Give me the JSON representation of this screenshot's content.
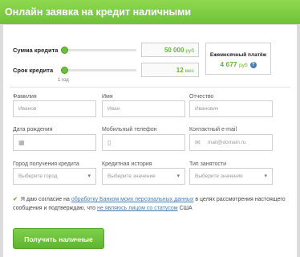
{
  "header": {
    "title": "Онлайн заявка на кредит наличными"
  },
  "sliders": [
    {
      "label": "Сумма кредита",
      "value": "50 000",
      "unit": "руб",
      "level": 0,
      "tick": ""
    },
    {
      "label": "Срок кредита",
      "value": "12",
      "unit": "мес",
      "level": 0,
      "tick": "1 год"
    }
  ],
  "payment": {
    "title": "Ежемесячный платёж",
    "value": "4 677",
    "unit": "руб",
    "help": "?"
  },
  "fields": {
    "last_name": {
      "label": "Фамилия",
      "placeholder": "Иванов"
    },
    "first_name": {
      "label": "Имя",
      "placeholder": "Иван"
    },
    "patronymic": {
      "label": "Отчество",
      "placeholder": "Иванович"
    },
    "birth_date": {
      "label": "Дата рождения",
      "placeholder": ""
    },
    "phone": {
      "label": "Мобильный телефон",
      "placeholder": ""
    },
    "email": {
      "label": "Контактный e-mail",
      "placeholder": "mail@domain.ru"
    },
    "city": {
      "label": "Город получения кредита",
      "placeholder": "Выберите город"
    },
    "credit_history": {
      "label": "Кредитная история",
      "placeholder": "Выберите значение"
    },
    "employment": {
      "label": "Тип занятости",
      "placeholder": "Выберите значение"
    }
  },
  "consent": {
    "part1": "Я даю согласие на",
    "link1": "обработку Банком моих персональных данных",
    "part2": "в целях рассмотрения настоящего сообщения и подтверждаю, что",
    "link2": "не являюсь лицом со статусом",
    "part3": "США"
  },
  "submit": {
    "label": "Получить наличные"
  }
}
